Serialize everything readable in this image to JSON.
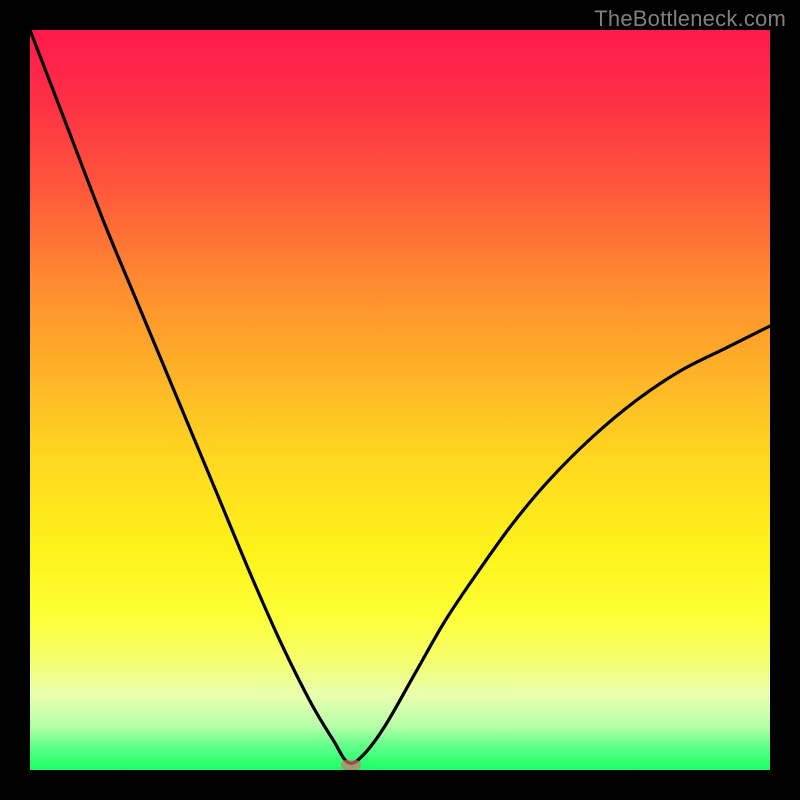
{
  "watermark": "TheBottleneck.com",
  "marker": {
    "x_frac": 0.434,
    "y_frac": 0.993
  },
  "chart_data": {
    "type": "line",
    "title": "",
    "xlabel": "",
    "ylabel": "",
    "x_range": [
      0,
      1
    ],
    "y_range": [
      0,
      1
    ],
    "colorscale": "green-yellow-red (bottom to top)",
    "series": [
      {
        "name": "bottleneck-curve",
        "x": [
          0.0,
          0.05,
          0.1,
          0.15,
          0.2,
          0.25,
          0.3,
          0.34,
          0.38,
          0.41,
          0.43,
          0.45,
          0.48,
          0.52,
          0.56,
          0.6,
          0.65,
          0.7,
          0.76,
          0.82,
          0.88,
          0.94,
          1.0
        ],
        "y": [
          0.0,
          0.13,
          0.26,
          0.38,
          0.5,
          0.62,
          0.74,
          0.83,
          0.91,
          0.96,
          0.99,
          0.98,
          0.94,
          0.87,
          0.8,
          0.74,
          0.67,
          0.61,
          0.55,
          0.5,
          0.46,
          0.43,
          0.4
        ]
      }
    ],
    "annotations": [
      {
        "type": "marker",
        "label": "optimal-point",
        "x": 0.434,
        "y": 0.007
      }
    ]
  }
}
